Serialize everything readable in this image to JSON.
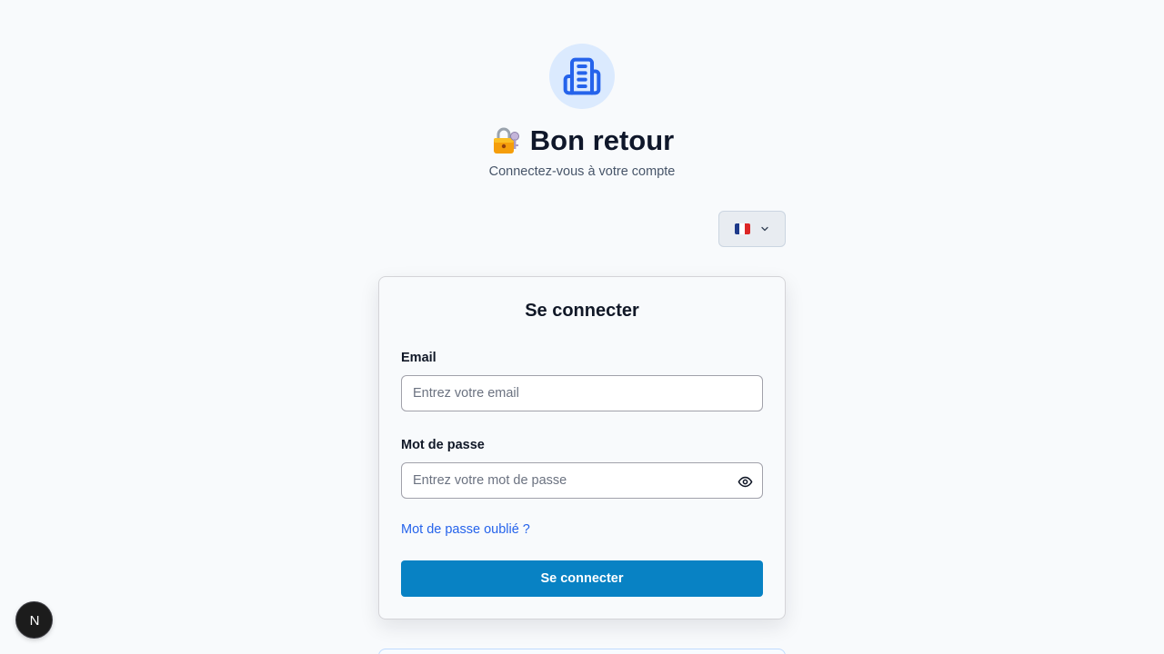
{
  "header": {
    "title": "Bon retour",
    "title_emoji": "🔐",
    "subtitle": "Connectez-vous à votre compte",
    "logo_icon": "building-icon"
  },
  "language_selector": {
    "selected": "fr",
    "flag_icon": "france-flag-icon",
    "chevron_icon": "chevron-down-icon"
  },
  "login_form": {
    "title": "Se connecter",
    "email_label": "Email",
    "email_placeholder": "Entrez votre email",
    "email_value": "",
    "password_label": "Mot de passe",
    "password_placeholder": "Entrez votre mot de passe",
    "password_value": "",
    "password_toggle_icon": "eye-icon",
    "forgot_password_link": "Mot de passe oublié ?",
    "submit_label": "Se connecter"
  },
  "dev_badge": {
    "label": "N"
  },
  "colors": {
    "primary_button": "#0882c4",
    "link": "#2563eb",
    "logo_bg": "#dbeafe",
    "logo_icon": "#2563eb",
    "page_bg": "#f8fafc"
  }
}
